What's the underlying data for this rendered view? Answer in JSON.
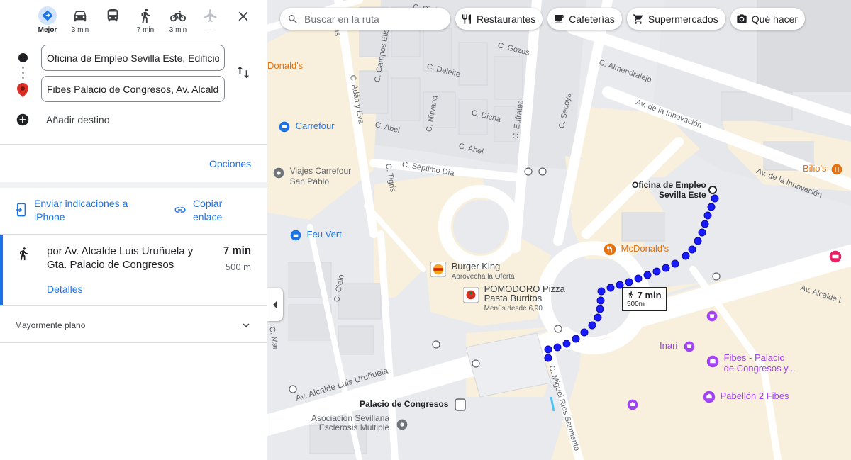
{
  "travel_modes": [
    {
      "id": "best",
      "icon": "directions-icon",
      "label": "Mejor",
      "active": true
    },
    {
      "id": "car",
      "icon": "car-icon",
      "label": "3 min"
    },
    {
      "id": "transit",
      "icon": "bus-icon",
      "label": ""
    },
    {
      "id": "walk",
      "icon": "walk-icon",
      "label": "7 min"
    },
    {
      "id": "bike",
      "icon": "bike-icon",
      "label": "3 min"
    },
    {
      "id": "flight",
      "icon": "plane-icon",
      "label": "—"
    }
  ],
  "origin": {
    "value": "Oficina de Empleo Sevilla Este, Edificio C"
  },
  "destination": {
    "value": "Fibes Palacio de Congresos, Av. Alcalde Lu"
  },
  "add_destination": "Añadir destino",
  "options_label": "Opciones",
  "send_to_phone": "Enviar indicaciones a iPhone",
  "copy_link": "Copiar enlace",
  "route": {
    "via": "por Av. Alcalde Luis Uruñuela y Gta. Palacio de Congresos",
    "duration": "7 min",
    "distance": "500 m",
    "details_label": "Detalles"
  },
  "terrain": "Mayormente plano",
  "map": {
    "search_placeholder": "Buscar en la ruta",
    "chips": [
      {
        "icon": "restaurant-icon",
        "label": "Restaurantes"
      },
      {
        "icon": "coffee-icon",
        "label": "Cafeterías"
      },
      {
        "icon": "cart-icon",
        "label": "Supermercados"
      },
      {
        "icon": "camera-icon",
        "label": "Qué hacer"
      }
    ],
    "walk_callout": {
      "duration": "7 min",
      "distance": "500m"
    },
    "origin_label_1": "Oficina de Empleo",
    "origin_label_2": "Sevilla Este",
    "places": {
      "mcdonalds_top": "Donald's",
      "carrefour": "Carrefour",
      "viajes_1": "Viajes Carrefour",
      "viajes_2": "San Pablo",
      "feu_vert": "Feu Vert",
      "mcdonalds": "McDonald's",
      "burger_king": "Burger King",
      "burger_king_sub": "Aprovecha la Oferta",
      "pomodoro_1": "POMODORO Pizza",
      "pomodoro_2": "Pasta Burritos",
      "pomodoro_sub": "Menús desde 6,90",
      "bilios": "Bilio's",
      "inari": "Inari",
      "fibes_1": "Fibes - Palacio",
      "fibes_2": "de Congresos y...",
      "pabellon": "Pabellón 2 Fibes",
      "palacio": "Palacio de Congresos",
      "asociacion_1": "Asociacion Sevillana",
      "asociacion_2": "Esclerosis Multiple"
    },
    "streets": {
      "almendralejo": "C. Almendralejo",
      "innovacion_1": "Av. de la Innovación",
      "innovacion_2": "Av. de la Innovación",
      "tigris_1": "C. Tigris",
      "tigris_2": "C. Tigris",
      "campos_eliseos": "C. Campos Elíseos",
      "adany_eva": "C. Adán y Eva",
      "deleite": "C. Deleite",
      "gozos": "C. Gozos",
      "eufrates": "C. Eufrates",
      "secoya": "C. Secoya",
      "dicha": "C. Dicha",
      "abel_1": "C. Abel",
      "abel_2": "C. Abel",
      "nirvana": "C. Nirvana",
      "septimo_dia": "C. Séptimo Día",
      "pison": "C. Pisón",
      "cielo": "C. Cielo",
      "mar": "C. Mar",
      "uruñuela": "Av. Alcalde Luis Uruñuela",
      "alcalde_l": "Av. Alcalde L",
      "sarmiento": "C. Miguel Ríos Sarmiento"
    }
  },
  "colors": {
    "accent": "#1a73e8",
    "route": "#1a1aff",
    "poi_orange": "#e8710a",
    "poi_blue": "#1a73e8",
    "poi_purple": "#a142f4"
  }
}
